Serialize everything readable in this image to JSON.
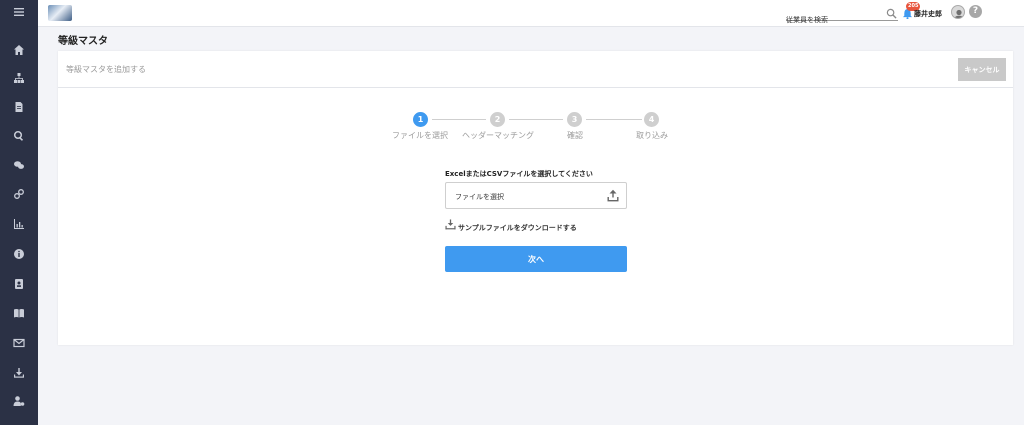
{
  "topbar": {
    "search_placeholder": "従業員を検索",
    "notification_count": "205",
    "user_name": "藤井史郎",
    "help_label": "?"
  },
  "page": {
    "title": "等級マスタ"
  },
  "card": {
    "header_title": "等級マスタを追加する",
    "cancel_label": "キャンセル"
  },
  "stepper": {
    "steps": [
      {
        "number": "1",
        "label": "ファイルを選択",
        "active": true
      },
      {
        "number": "2",
        "label": "ヘッダーマッチング",
        "active": false
      },
      {
        "number": "3",
        "label": "確認",
        "active": false
      },
      {
        "number": "4",
        "label": "取り込み",
        "active": false
      }
    ]
  },
  "form": {
    "file_label": "ExcelまたはCSVファイルを選択してください",
    "file_placeholder": "ファイルを選択",
    "sample_download_label": "サンプルファイルをダウンロードする",
    "next_label": "次へ"
  },
  "sidebar": {
    "icons": [
      "menu-icon",
      "home-icon",
      "org-chart-icon",
      "document-icon",
      "search-icon",
      "chat-icon",
      "link-icon",
      "chart-icon",
      "info-icon",
      "contact-icon",
      "book-icon",
      "mail-icon",
      "download-icon",
      "user-settings-icon"
    ]
  },
  "colors": {
    "sidebar_bg": "#2b3145",
    "primary": "#3f9af0",
    "badge": "#e8553e",
    "cancel_bg": "#c9c9c9"
  }
}
